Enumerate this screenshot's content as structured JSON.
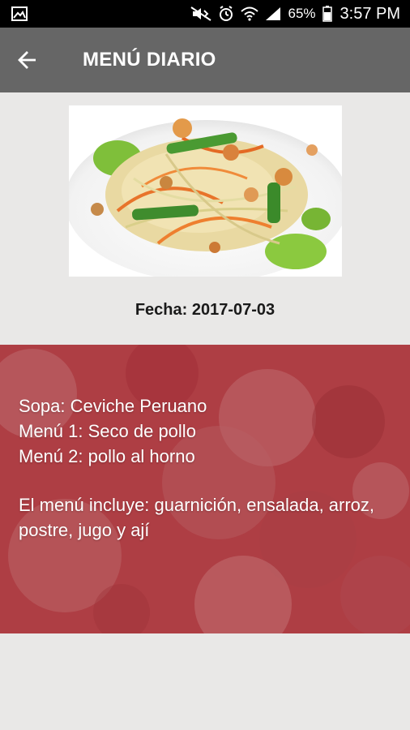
{
  "status_bar": {
    "battery_percent": "65%",
    "time": "3:57 PM",
    "icons": [
      "image-icon",
      "mute-icon",
      "alarm-icon",
      "wifi-icon",
      "signal-icon",
      "battery-icon"
    ]
  },
  "app_bar": {
    "title": "MENÚ DIARIO",
    "back_icon": "arrow-back-icon",
    "color": "#666666"
  },
  "dish": {
    "image": "pasta-salad-photo"
  },
  "date": {
    "text": "Fecha: 2017-07-03"
  },
  "menu": {
    "sopa": "Sopa: Ceviche Peruano",
    "menu1": "Menú 1: Seco de pollo",
    "menu2": "Menú 2: pollo al horno",
    "includes": "El menú incluye: guarnición, ensalada, arroz, postre, jugo y ají",
    "overlay_color": "#a5323a"
  }
}
